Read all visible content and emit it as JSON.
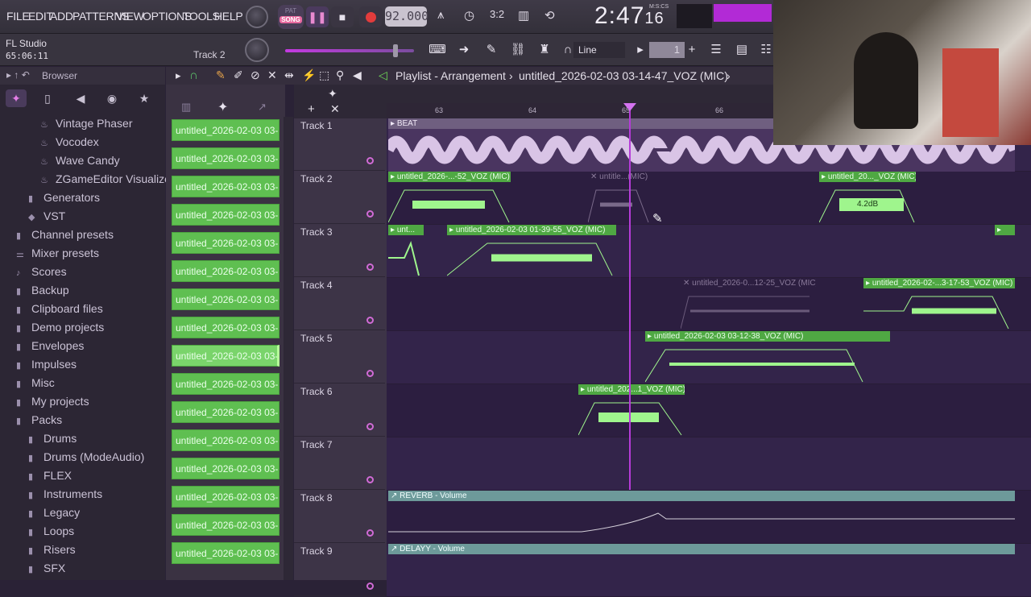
{
  "menu": [
    "FILE",
    "EDIT",
    "ADD",
    "PATTERNS",
    "VIEW",
    "OPTIONS",
    "TOOLS",
    "HELP"
  ],
  "transport": {
    "pat": "PAT",
    "song": "SONG",
    "pause": "❚❚",
    "stop": "■",
    "tempo": "92.000"
  },
  "clock": {
    "main": "2:47",
    "sub": "16",
    "label": "M:S:CS"
  },
  "hint": {
    "title": "FL Studio",
    "time": "65:06:11",
    "track": "Track 2"
  },
  "snap": {
    "value": "Line"
  },
  "pattern": {
    "number": "1"
  },
  "browser": {
    "title": "Browser",
    "items": [
      {
        "label": "Vintage Phaser",
        "icon": "plugin-icon",
        "indent": 2
      },
      {
        "label": "Vocodex",
        "icon": "plugin-icon",
        "indent": 2
      },
      {
        "label": "Wave Candy",
        "icon": "plugin-icon",
        "indent": 2
      },
      {
        "label": "ZGameEditor Visualizer",
        "icon": "plugin-icon",
        "indent": 2
      },
      {
        "label": "Generators",
        "icon": "folder-icon",
        "indent": 1
      },
      {
        "label": "VST",
        "icon": "plug-icon",
        "indent": 1
      },
      {
        "label": "Channel presets",
        "icon": "folder-icon",
        "indent": 0
      },
      {
        "label": "Mixer presets",
        "icon": "mixer-icon",
        "indent": 0
      },
      {
        "label": "Scores",
        "icon": "note-icon",
        "indent": 0
      },
      {
        "label": "Backup",
        "icon": "folder-icon",
        "indent": 0
      },
      {
        "label": "Clipboard files",
        "icon": "folder-icon",
        "indent": 0
      },
      {
        "label": "Demo projects",
        "icon": "folder-icon",
        "indent": 0
      },
      {
        "label": "Envelopes",
        "icon": "folder-icon",
        "indent": 0
      },
      {
        "label": "Impulses",
        "icon": "folder-icon",
        "indent": 0
      },
      {
        "label": "Misc",
        "icon": "folder-icon",
        "indent": 0
      },
      {
        "label": "My projects",
        "icon": "folder-icon",
        "indent": 0
      },
      {
        "label": "Packs",
        "icon": "folder-icon",
        "indent": 0
      },
      {
        "label": "Drums",
        "icon": "folder-icon",
        "indent": 1
      },
      {
        "label": "Drums (ModeAudio)",
        "icon": "folder-icon",
        "indent": 1
      },
      {
        "label": "FLEX",
        "icon": "folder-icon",
        "indent": 1
      },
      {
        "label": "Instruments",
        "icon": "folder-icon",
        "indent": 1
      },
      {
        "label": "Legacy",
        "icon": "folder-icon",
        "indent": 1
      },
      {
        "label": "Loops",
        "icon": "folder-icon",
        "indent": 1
      },
      {
        "label": "Risers",
        "icon": "folder-icon",
        "indent": 1
      },
      {
        "label": "SFX",
        "icon": "folder-icon",
        "indent": 1
      }
    ]
  },
  "picker": {
    "clips": [
      "untitled_2026-02-03 03-...",
      "untitled_2026-02-03 03-...",
      "untitled_2026-02-03 03-...",
      "untitled_2026-02-03 03-...",
      "untitled_2026-02-03 03-...",
      "untitled_2026-02-03 03-...",
      "untitled_2026-02-03 03-...",
      "untitled_2026-02-03 03-...",
      "untitled_2026-02-03 03-...",
      "untitled_2026-02-03 03-...",
      "untitled_2026-02-03 03-...",
      "untitled_2026-02-03 03-...",
      "untitled_2026-02-03 03-...",
      "untitled_2026-02-03 03-...",
      "untitled_2026-02-03 03-...",
      "untitled_2026-02-03 03-..."
    ]
  },
  "playlist": {
    "title": "Playlist - Arrangement",
    "file": "untitled_2026-02-03 03-14-47_VOZ (MIC)",
    "bars": [
      "63",
      "64",
      "65",
      "66"
    ],
    "tracks": [
      "Track 1",
      "Track 2",
      "Track 3",
      "Track 4",
      "Track 5",
      "Track 6",
      "Track 7",
      "Track 8",
      "Track 9"
    ],
    "clips": {
      "beat": "BEAT",
      "t2a": "untitled_2026-...-52_VOZ (MIC)",
      "t2b": "untitle...(MIC)",
      "t2c": "untitled_20..._VOZ (MIC)",
      "t3a": "unt...",
      "t3b": "untitled_2026-02-03 01-39-55_VOZ (MIC)",
      "t4a": "untitled_2026-0...12-25_VOZ (MIC)",
      "t4b": "untitled_2026-02-...3-17-53_VOZ (MIC)",
      "t5": "untitled_2026-02-03 03-12-38_VOZ (MIC)",
      "t6": "untitled_202...1_VOZ (MIC)",
      "t8": "REVERB - Volume",
      "t9": "DELAYY - Volume"
    },
    "gain": "4.2dB"
  }
}
